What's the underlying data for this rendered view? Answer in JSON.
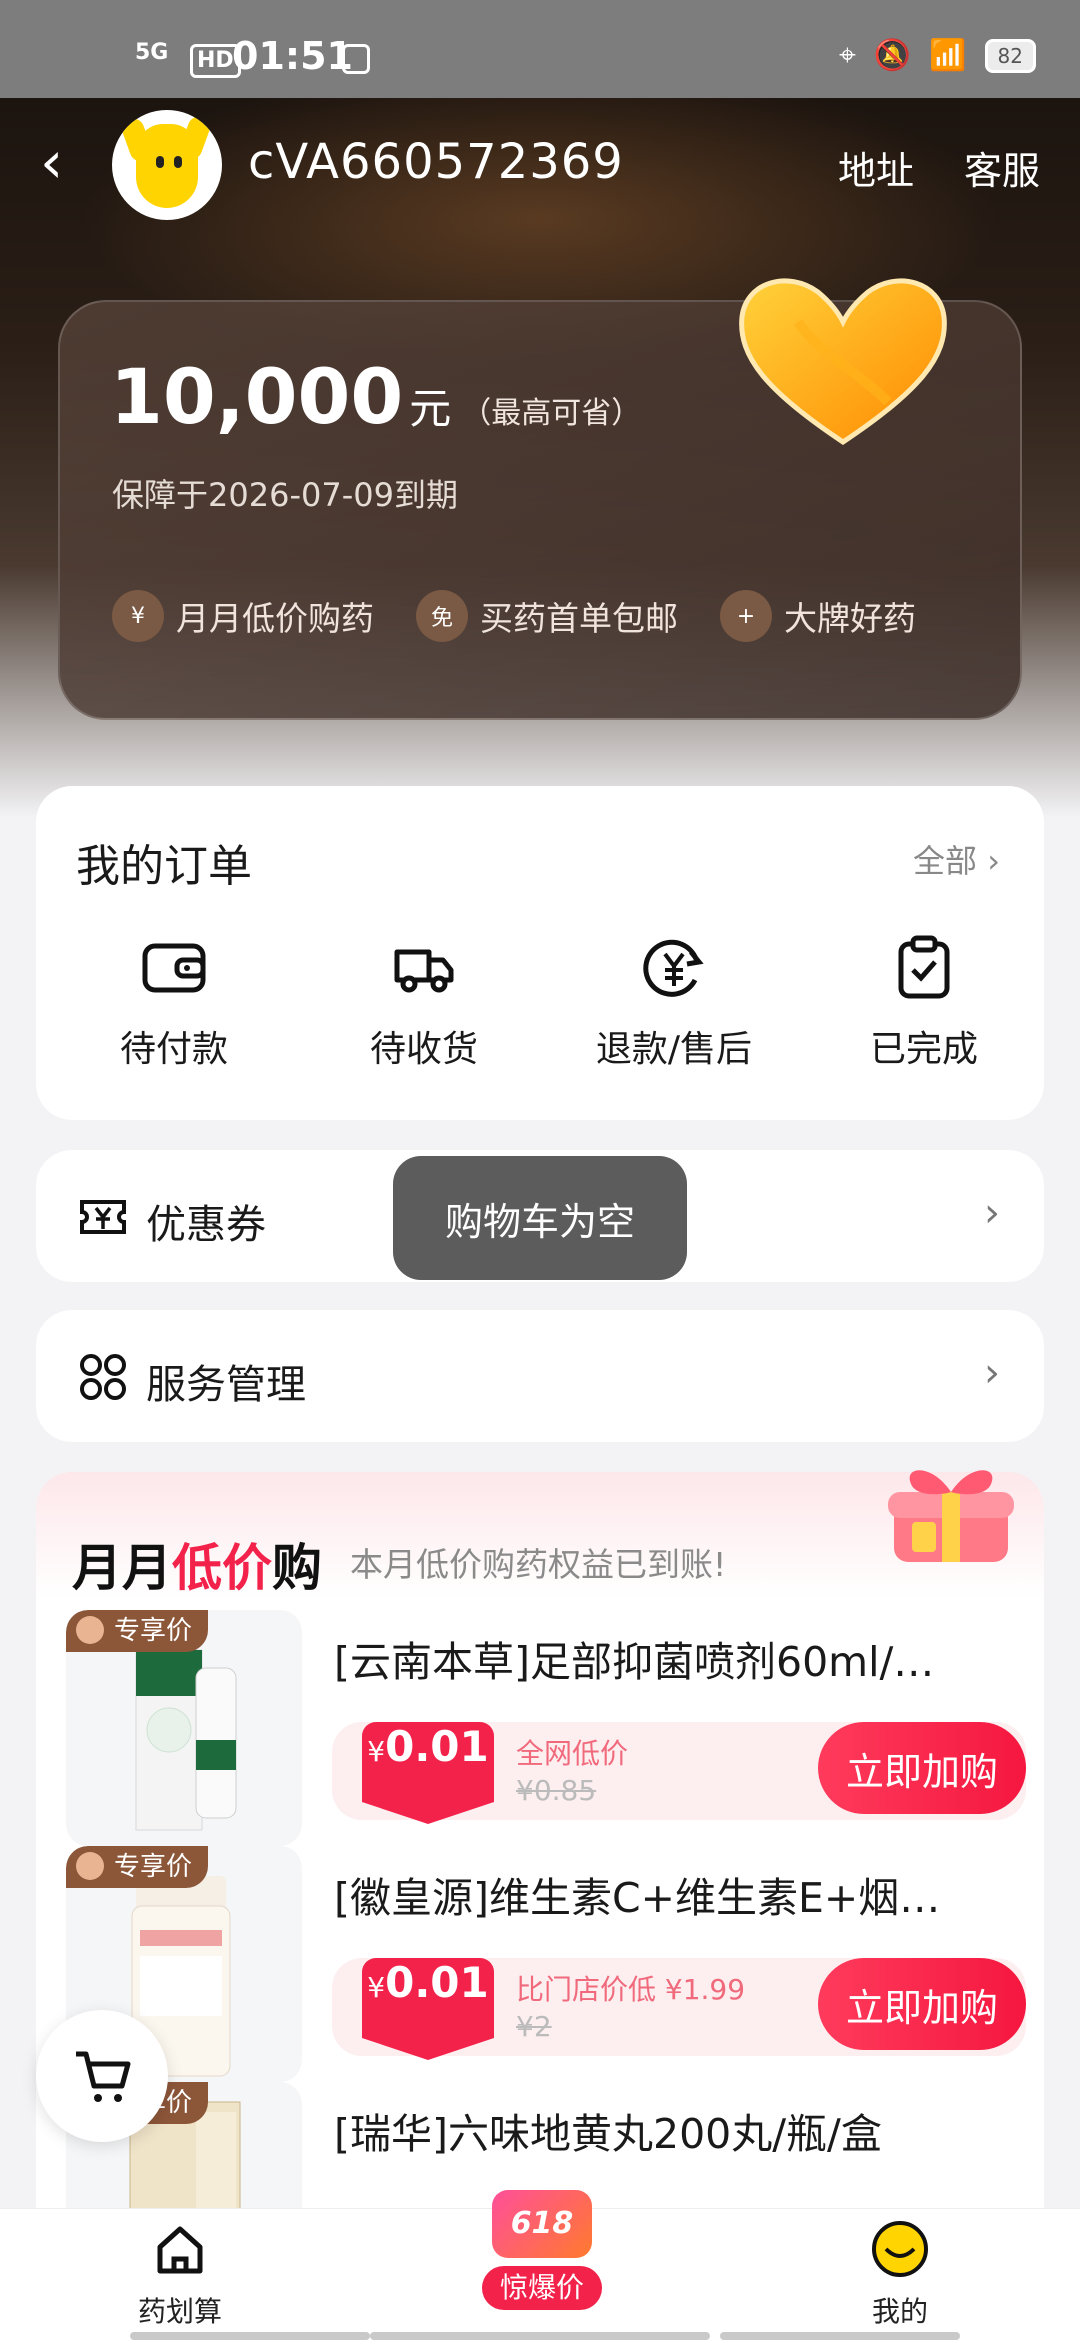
{
  "status_bar": {
    "signal": "5G",
    "hd": "HD",
    "time": "01:51",
    "battery": "82"
  },
  "header": {
    "username": "cVA660572369",
    "address_link": "地址",
    "service_link": "客服"
  },
  "benefit_card": {
    "amount": "10,000",
    "unit": "元",
    "note": "（最高可省）",
    "expire": "保障于2026-07-09到期",
    "perks": [
      {
        "icon": "¥",
        "label": "月月低价购药"
      },
      {
        "icon": "免",
        "label": "买药首单包邮"
      },
      {
        "icon": "+",
        "label": "大牌好药"
      }
    ]
  },
  "orders": {
    "title": "我的订单",
    "all_label": "全部 ›",
    "items": [
      {
        "icon": "wallet-icon",
        "label": "待付款"
      },
      {
        "icon": "truck-icon",
        "label": "待收货"
      },
      {
        "icon": "refund-icon",
        "label": "退款/售后"
      },
      {
        "icon": "clipboard-check-icon",
        "label": "已完成"
      }
    ]
  },
  "coupon": {
    "label": "优惠券",
    "chevron": "›"
  },
  "service": {
    "label": "服务管理",
    "chevron": "›"
  },
  "toast": "购物车为空",
  "deals": {
    "title_pre": "月月",
    "title_hl": "低价",
    "title_post": "购",
    "subtitle": "本月低价购药权益已到账!",
    "tag": "专享价",
    "buy_label": "立即加购",
    "items": [
      {
        "name": "[云南本草]足部抑菌喷剂60ml/…",
        "currency": "¥",
        "price": "0.01",
        "tip": "全网低价",
        "orig": "¥0.85"
      },
      {
        "name": "[徽皇源]维生素C+维生素E+烟…",
        "currency": "¥",
        "price": "0.01",
        "tip": "比门店价低 ¥1.99",
        "orig": "¥2"
      },
      {
        "name": "[瑞华]六味地黄丸200丸/瓶/盒",
        "currency": "",
        "price": "",
        "tip": "",
        "orig": ""
      }
    ]
  },
  "tabbar": {
    "tab1": "药划算",
    "promo_badge": "618",
    "promo_label": "惊爆价",
    "tab3": "我的"
  },
  "colors": {
    "accent": "#f3224b",
    "dark_header": "#2b1f17",
    "toast": "#5c5c5c"
  }
}
